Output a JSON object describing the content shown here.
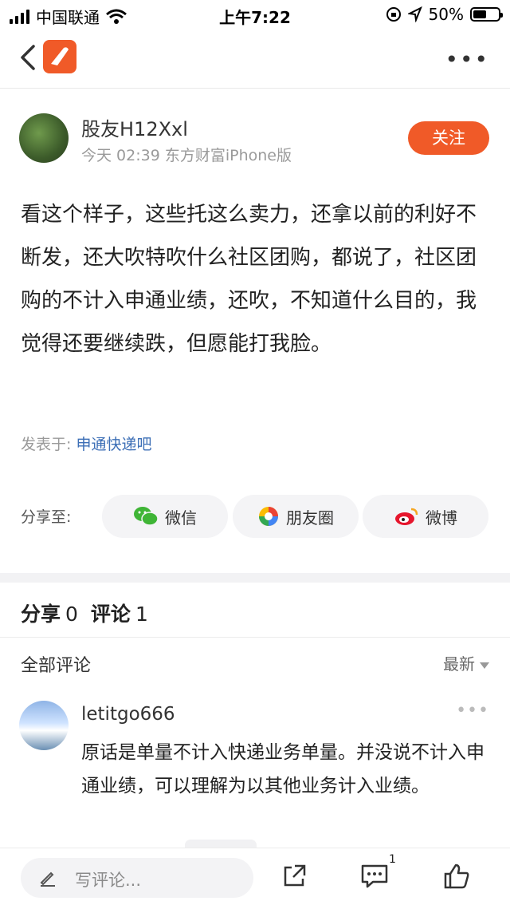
{
  "status_bar": {
    "carrier": "中国联通",
    "time": "上午7:22",
    "battery": "50%"
  },
  "post": {
    "author": "股友H12Xxl",
    "meta": "今天 02:39  东方财富iPhone版",
    "follow_label": "关注",
    "text": "看这个样子，这些托这么卖力，还拿以前的利好不断发，还大吹特吹什么社区团购，都说了，社区团购的不计入申通业绩，还吹，不知道什么目的，我觉得还要继续跌，但愿能打我脸。",
    "posted_in_label": "发表于:",
    "posted_in_bar": "申通快递吧"
  },
  "share": {
    "label": "分享至:",
    "wechat": "微信",
    "moments": "朋友圈",
    "weibo": "微博"
  },
  "counts": {
    "share_label": "分享",
    "share_count": "0",
    "comment_label": "评论",
    "comment_count": "1"
  },
  "comments_header": {
    "title": "全部评论",
    "sort": "最新"
  },
  "comments": [
    {
      "user": "letitgo666",
      "text": "原话是单量不计入快递业务单量。并没说不计入申通业绩，可以理解为以其他业务计入业绩。"
    }
  ],
  "bottom_bar": {
    "placeholder": "写评论...",
    "comment_badge": "1"
  },
  "colors": {
    "accent": "#f05a28",
    "link": "#3d6fb6"
  }
}
